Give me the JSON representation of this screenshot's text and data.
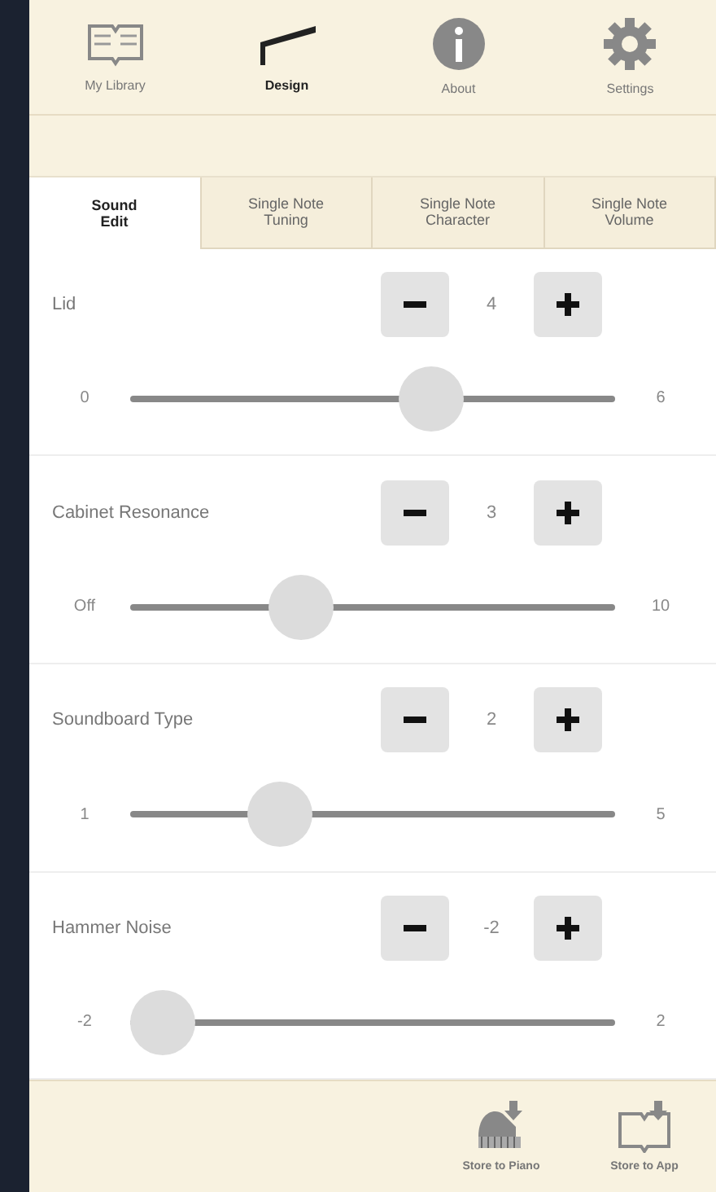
{
  "toolbar": [
    {
      "label": "My Library",
      "kind": "book",
      "selected": false
    },
    {
      "label": "Design",
      "kind": "piano",
      "selected": true
    },
    {
      "label": "About",
      "kind": "info",
      "selected": false
    },
    {
      "label": "Settings",
      "kind": "gear",
      "selected": false
    }
  ],
  "tabs": [
    {
      "label": "Sound\nEdit",
      "selected": true
    },
    {
      "label": "Single Note\nTuning",
      "selected": false
    },
    {
      "label": "Single Note\nCharacter",
      "selected": false
    },
    {
      "label": "Single Note\nVolume",
      "selected": false
    }
  ],
  "settings": [
    {
      "name": "Lid",
      "value": "4",
      "min": "0",
      "max": "6",
      "level": 0.64
    },
    {
      "name": "Cabinet Resonance",
      "value": "3",
      "min": "Off",
      "max": "10",
      "level": 0.33
    },
    {
      "name": "Soundboard Type",
      "value": "2",
      "min": "1",
      "max": "5",
      "level": 0.28
    },
    {
      "name": "Hammer Noise",
      "value": "-2",
      "min": "-2",
      "max": "2",
      "level": 0
    }
  ],
  "bottom_bar": [
    {
      "label": "Store to Piano",
      "kind": "piano"
    },
    {
      "label": "Store to App",
      "kind": "book"
    }
  ]
}
